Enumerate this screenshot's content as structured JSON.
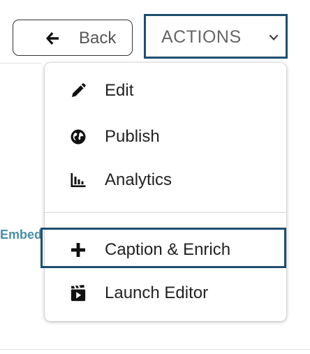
{
  "header": {
    "back_label": "Back",
    "actions_label": "ACTIONS"
  },
  "menu": {
    "items": [
      {
        "label": "Edit",
        "icon": "pencil-icon"
      },
      {
        "label": "Publish",
        "icon": "globe-icon"
      },
      {
        "label": "Analytics",
        "icon": "bar-chart-icon"
      },
      {
        "label": "Caption & Enrich",
        "icon": "plus-icon"
      },
      {
        "label": "Launch Editor",
        "icon": "clapperboard-icon"
      }
    ]
  },
  "side": {
    "embed_label": "Embed"
  },
  "colors": {
    "highlight": "#1f4e6e",
    "text": "#222222",
    "link": "#4a8fa8"
  }
}
